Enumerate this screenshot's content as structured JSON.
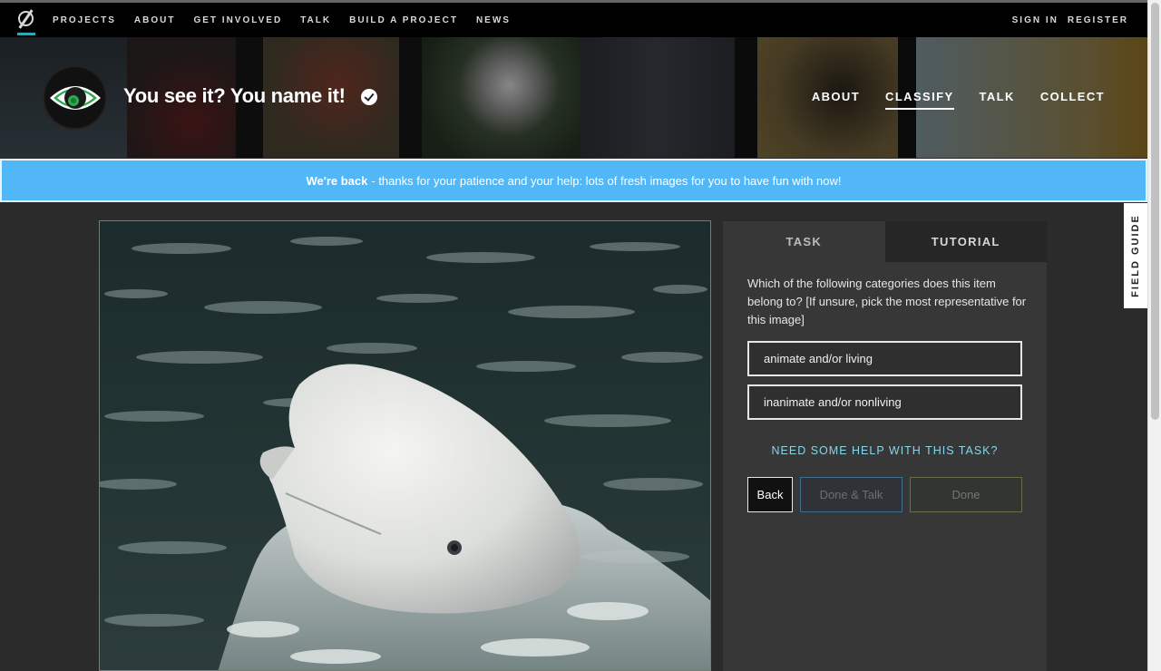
{
  "topnav": {
    "left_links": [
      "PROJECTS",
      "ABOUT",
      "GET INVOLVED",
      "TALK",
      "BUILD A PROJECT",
      "NEWS"
    ],
    "right_links": [
      "SIGN IN",
      "REGISTER"
    ]
  },
  "project": {
    "title": "You see it? You name it!",
    "nav": [
      "ABOUT",
      "CLASSIFY",
      "TALK",
      "COLLECT"
    ],
    "active_nav": "CLASSIFY"
  },
  "banner": {
    "strong": "We're back",
    "text": "- thanks for your patience and your help: lots of fresh images for you to have fun with now!"
  },
  "field_guide": {
    "label": "FIELD GUIDE"
  },
  "panel": {
    "tabs": [
      "TASK",
      "TUTORIAL"
    ],
    "active_tab": "TASK",
    "question": "Which of the following categories does this item belong to? [If unsure, pick the most representative for this image]",
    "answers": [
      "animate and/or living",
      "inanimate and/or nonliving"
    ],
    "help_link": "NEED SOME HELP WITH THIS TASK?",
    "buttons": {
      "back": "Back",
      "done_talk": "Done & Talk",
      "done": "Done"
    }
  },
  "colors": {
    "banner": "#51b7f7",
    "help_link": "#8ad4e6",
    "panel": "#373737",
    "avatar_eye_iris": "#2fa84f"
  }
}
